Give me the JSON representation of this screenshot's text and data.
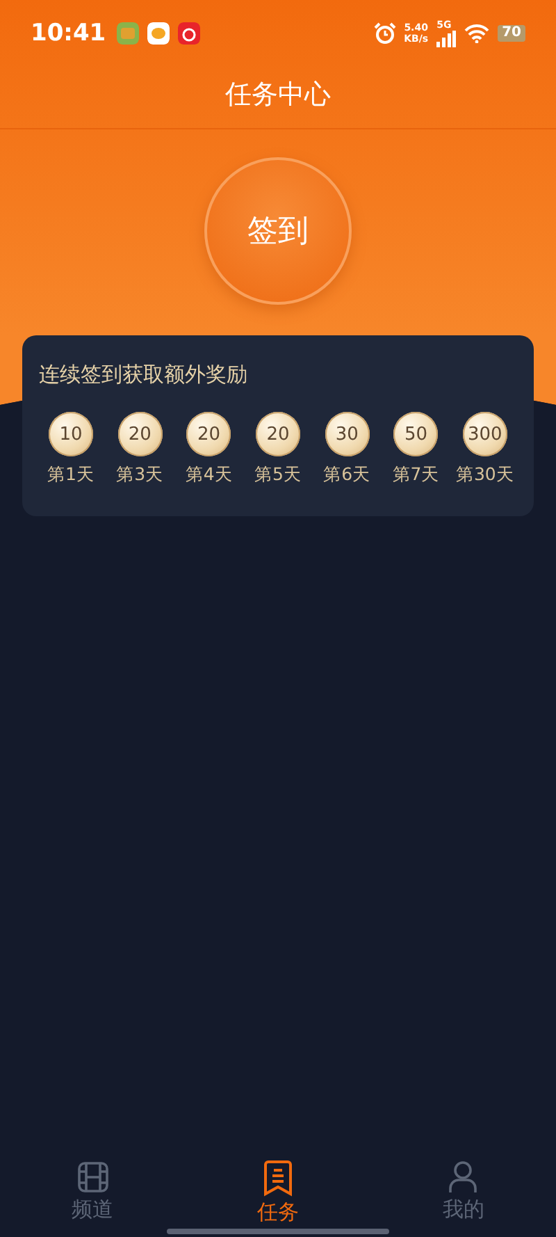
{
  "status_bar": {
    "time": "10:41",
    "net_speed": "5.40",
    "net_unit": "KB/s",
    "network": "5G",
    "battery": "70"
  },
  "header": {
    "title": "任务中心"
  },
  "sign_in": {
    "label": "签到"
  },
  "rewards": {
    "title": "连续签到获取额外奖励",
    "days": [
      {
        "points": "10",
        "day": "第1天"
      },
      {
        "points": "20",
        "day": "第3天"
      },
      {
        "points": "20",
        "day": "第4天"
      },
      {
        "points": "20",
        "day": "第5天"
      },
      {
        "points": "30",
        "day": "第6天"
      },
      {
        "points": "50",
        "day": "第7天"
      },
      {
        "points": "300",
        "day": "第30天"
      }
    ]
  },
  "tabs": [
    {
      "label": "频道",
      "kind": "film",
      "selected": false
    },
    {
      "label": "任务",
      "kind": "task",
      "selected": true
    },
    {
      "label": "我的",
      "kind": "user",
      "selected": false
    }
  ]
}
